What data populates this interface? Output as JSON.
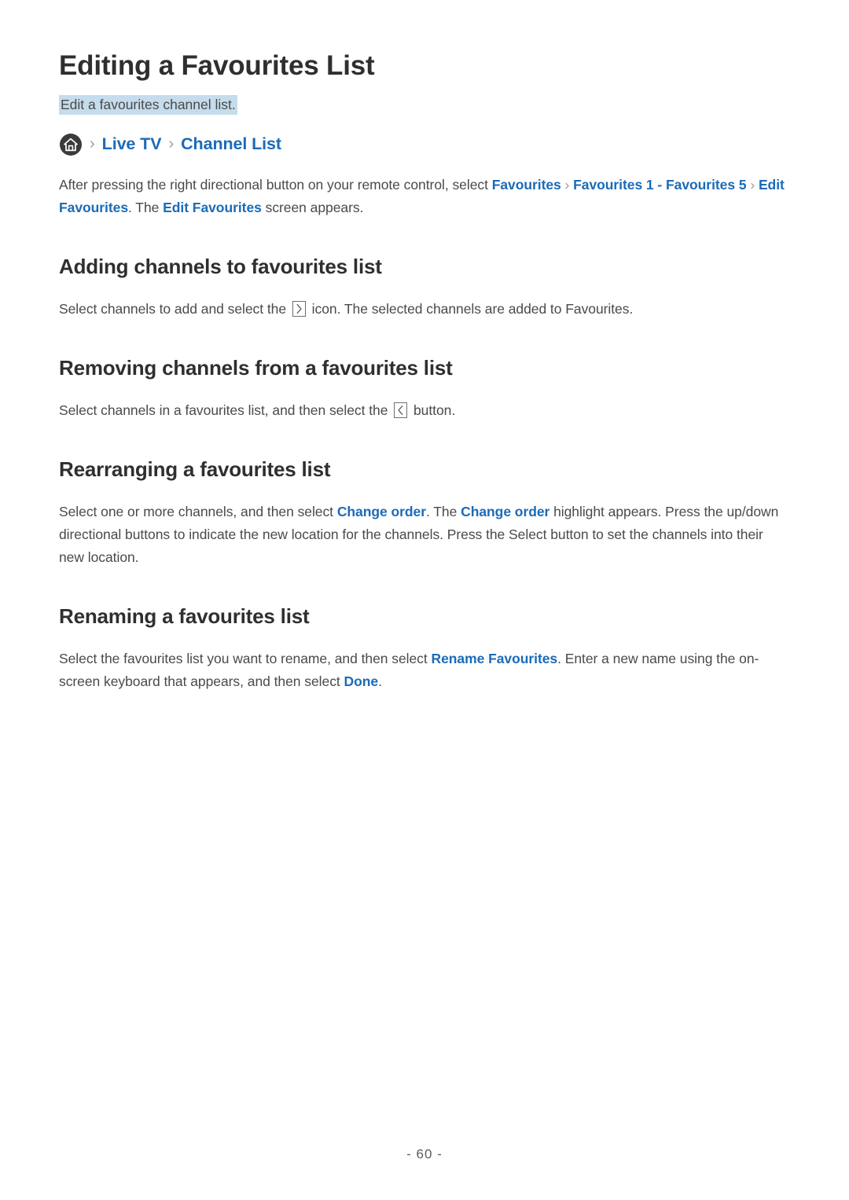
{
  "document": {
    "title": "Editing a Favourites List",
    "subtitle": "Edit a favourites channel list.",
    "page_number": "- 60 -",
    "accent_link_color": "#1b6bb8",
    "highlight_color": "#c5dcec",
    "text_color": "#4a4a4a",
    "separator_color": "#9a9a9a"
  },
  "breadcrumb": {
    "home_icon": "home-icon",
    "separator": "›",
    "items": [
      {
        "label": "Live TV"
      },
      {
        "label": "Channel List"
      }
    ]
  },
  "intro": {
    "part1": "After pressing the right directional button on your remote control, select ",
    "link1": "Favourites",
    "sep1": "›",
    "link2": "Favourites 1 - Favourites 5",
    "sep2": "›",
    "link3": "Edit Favourites",
    "part2": ". The ",
    "link4": "Edit Favourites",
    "part3": " screen appears."
  },
  "sections": [
    {
      "heading": "Adding channels to favourites list",
      "body_part1": "Select channels to add and select the ",
      "icon": "chevron-right-key-icon",
      "body_part2": " icon. The selected channels are added to Favourites."
    },
    {
      "heading": "Removing channels from a favourites list",
      "body_part1": "Select channels in a favourites list, and then select the ",
      "icon": "chevron-left-key-icon",
      "body_part2": " button."
    },
    {
      "heading": "Rearranging a favourites list",
      "body_part1": "Select one or more channels, and then select ",
      "link1": "Change order",
      "body_part2": ". The ",
      "link2": "Change order",
      "body_part3": " highlight appears. Press the up/down directional buttons to indicate the new location for the channels. Press the Select button to set the channels into their new location."
    },
    {
      "heading": "Renaming a favourites list",
      "body_part1": "Select the favourites list you want to rename, and then select ",
      "link1": "Rename Favourites",
      "body_part2": ". Enter a new name using the on-screen keyboard that appears, and then select ",
      "link2": "Done",
      "body_part3": "."
    }
  ]
}
